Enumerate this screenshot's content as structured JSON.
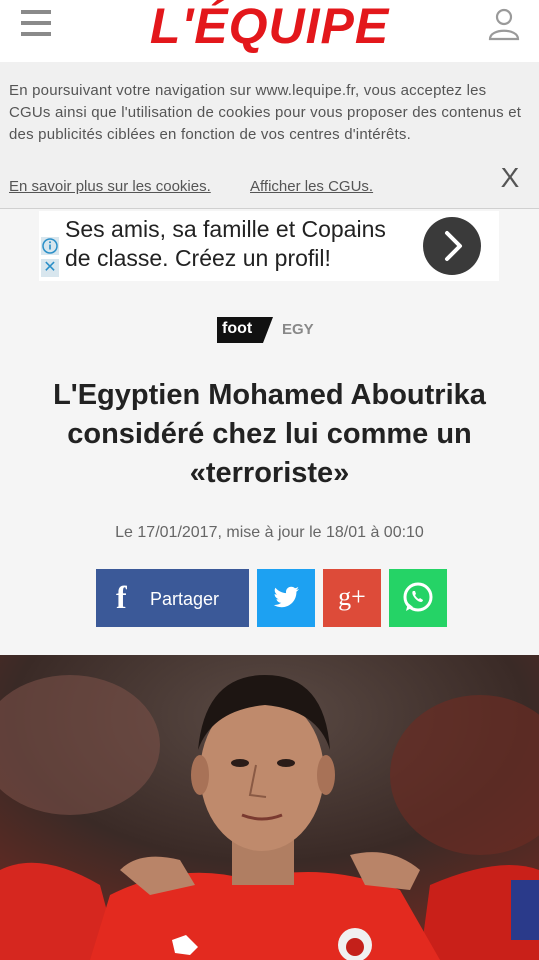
{
  "header": {
    "logo": "L'ÉQUIPE",
    "menu_icon": "hamburger-menu-icon",
    "user_icon": "user-account-icon"
  },
  "cookie_banner": {
    "text": "En poursuivant votre navigation sur www.lequipe.fr, vous acceptez les CGUs ainsi que l'utilisation de cookies pour vous proposer des contenus et des publicités ciblées en fonction de vos centres d'intérêts.",
    "link_cookies": "En savoir plus sur les cookies.",
    "link_cgu": "Afficher les CGUs.",
    "close": "X"
  },
  "ad": {
    "text": "Ses amis, sa famille et Copains de classe. Créez un profil!",
    "info_icon": "info-icon",
    "close_icon": "close-icon",
    "arrow_icon": "chevron-right-icon"
  },
  "article": {
    "tag_sport": "foot",
    "tag_country": "EGY",
    "title": "L'Egyptien Mohamed Aboutrika considéré chez lui comme un «terroriste»",
    "date": "Le 17/01/2017, mise à jour le 18/01 à 00:10"
  },
  "share": {
    "facebook_label": "Partager",
    "facebook_icon": "facebook-icon",
    "twitter_icon": "twitter-icon",
    "googleplus_label": "g+",
    "whatsapp_icon": "whatsapp-icon"
  },
  "colors": {
    "brand_red": "#e3171b",
    "facebook": "#3b5998",
    "twitter": "#1da1f2",
    "googleplus": "#dd4b39",
    "whatsapp": "#25d366"
  }
}
